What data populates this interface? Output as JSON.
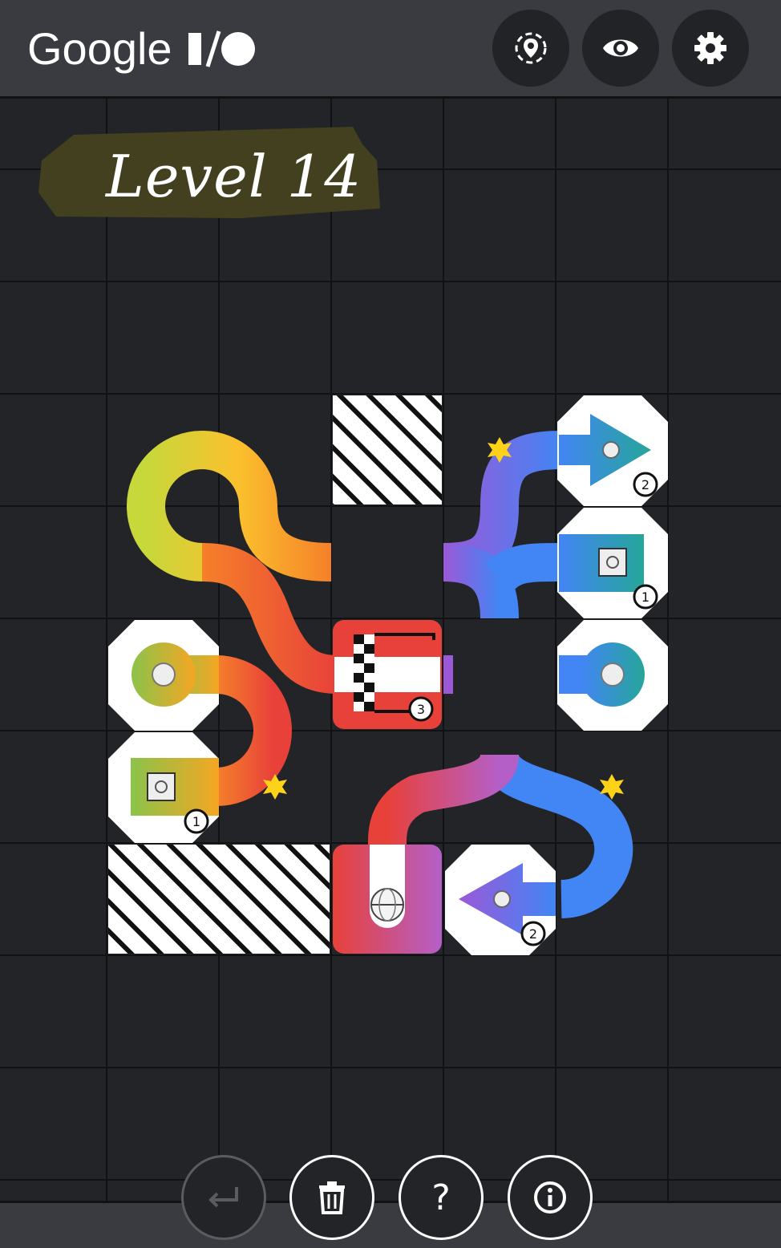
{
  "header": {
    "brand_word": "Google",
    "brand_suffix": "I/O",
    "buttons": [
      "location-icon",
      "eye-icon",
      "gear-icon"
    ]
  },
  "level": {
    "title": "Level 14"
  },
  "tiles": {
    "finish_counter": "3",
    "goal_top_right_counter": "2",
    "goal_square_counter": "1",
    "goal_left_counter": "1",
    "goal_bottom_counter": "2"
  },
  "controls": {
    "undo_icon": "undo-icon",
    "delete_icon": "trash-icon",
    "help_label": "?",
    "info_icon": "info-icon"
  },
  "colors": {
    "background": "#232427",
    "header": "#3a3b40",
    "track_red": "#e8413a",
    "track_orange": "#f5802a",
    "track_yellow": "#fbc02d",
    "track_blue": "#4285f4",
    "track_purple": "#9b59d8",
    "track_teal": "#26a69a",
    "spark": "#ffd21a"
  }
}
